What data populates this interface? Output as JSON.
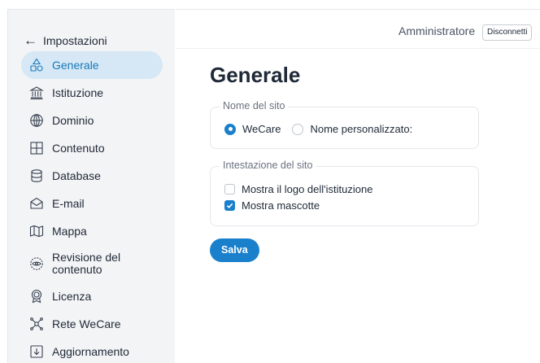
{
  "sidebar": {
    "back_label": "Impostazioni",
    "items": [
      {
        "label": "Generale",
        "icon": "shapes-icon",
        "active": true
      },
      {
        "label": "Istituzione",
        "icon": "institution-icon"
      },
      {
        "label": "Dominio",
        "icon": "globe-icon"
      },
      {
        "label": "Contenuto",
        "icon": "grid-icon"
      },
      {
        "label": "Database",
        "icon": "database-icon"
      },
      {
        "label": "E-mail",
        "icon": "mail-icon"
      },
      {
        "label": "Mappa",
        "icon": "map-icon"
      },
      {
        "label": "Revisione del\ncontenuto",
        "icon": "review-eye-icon"
      },
      {
        "label": "Licenza",
        "icon": "license-seal-icon"
      },
      {
        "label": "Rete WeCare",
        "icon": "network-icon"
      },
      {
        "label": "Aggiornamento",
        "icon": "update-download-icon"
      }
    ]
  },
  "header": {
    "user": "Amministratore",
    "logout_label": "Disconnetti"
  },
  "main": {
    "title": "Generale",
    "site_name": {
      "legend": "Nome del sito",
      "options": [
        {
          "label": "WeCare",
          "selected": true
        },
        {
          "label": "Nome personalizzato:",
          "selected": false
        }
      ]
    },
    "site_header": {
      "legend": "Intestazione del sito",
      "options": [
        {
          "label": "Mostra il logo dell'istituzione",
          "checked": false
        },
        {
          "label": "Mostra mascotte",
          "checked": true
        }
      ]
    },
    "save_label": "Salva"
  },
  "colors": {
    "accent": "#1a80cc",
    "active_bg": "#d6e8f5",
    "sidebar_bg": "#f3f4f6"
  }
}
